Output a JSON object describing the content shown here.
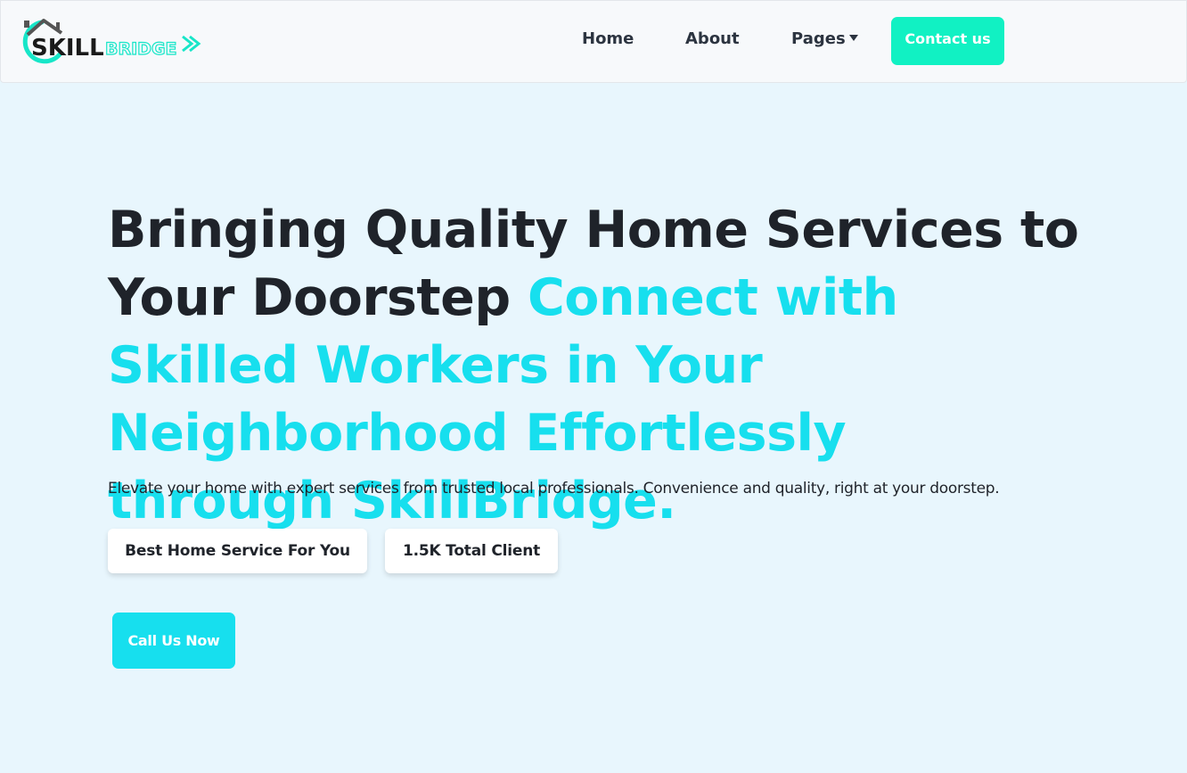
{
  "header": {
    "logo": {
      "text_primary": "SKILL",
      "text_secondary": "BRIDGE",
      "colors": {
        "primary": "#1a1a1a",
        "accent": "#17e6c8"
      }
    },
    "nav": {
      "home": "Home",
      "about": "About",
      "pages": "Pages",
      "contact": "Contact us"
    }
  },
  "hero": {
    "title_dark": "Bringing Quality Home Services to Your Doorstep ",
    "title_accent": "Connect with Skilled Workers in Your Neighborhood Effortlessly through SkillBridge.",
    "subtitle": "Elevate your home with expert services from trusted local professionals. Convenience and quality, right at your doorstep.",
    "chips": [
      "Best Home Service For You",
      "1.5K Total Client"
    ],
    "cta": "Call Us Now"
  },
  "colors": {
    "page_bg": "#e8f6fd",
    "accent_cyan": "#17dfee",
    "contact_btn": "#11f1c3",
    "text_dark": "#1f232a"
  },
  "icons": {
    "pages_caret": "caret-down-icon"
  }
}
